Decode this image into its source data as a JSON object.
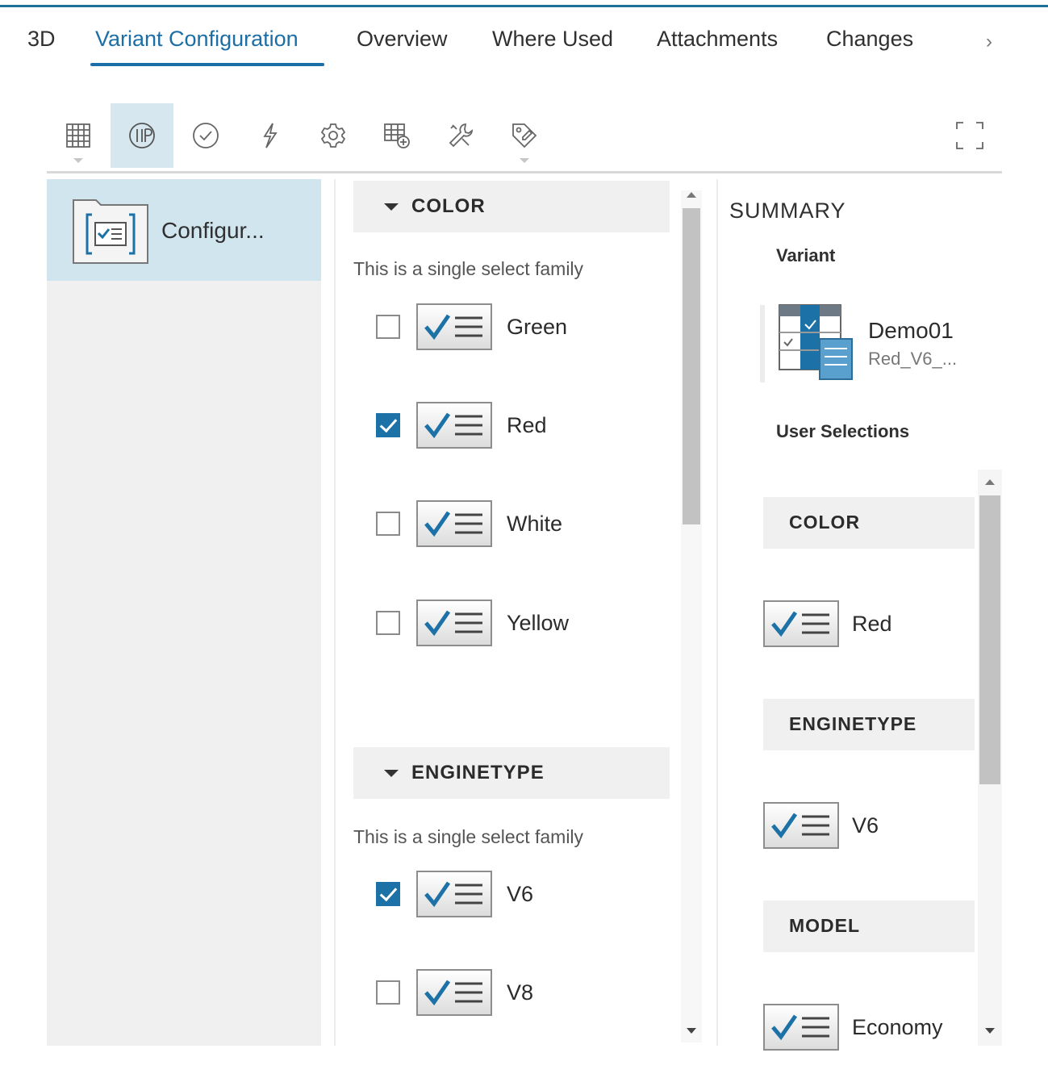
{
  "tabs": [
    {
      "label": "3D"
    },
    {
      "label": "Variant Configuration"
    },
    {
      "label": "Overview"
    },
    {
      "label": "Where Used"
    },
    {
      "label": "Attachments"
    },
    {
      "label": "Changes"
    }
  ],
  "active_tab": "Variant Configuration",
  "toolbar": {
    "tools": [
      "grid-view-icon",
      "feature-options-icon",
      "validate-check-icon",
      "rules-lightning-icon",
      "settings-gear-icon",
      "add-table-icon",
      "tools-wrench-icon",
      "tag-edit-icon"
    ],
    "active_tool": "feature-options-icon",
    "fullscreen": "fullscreen-icon"
  },
  "tree": {
    "items": [
      {
        "label": "Configur...",
        "icon": "configuration-folder-icon"
      }
    ]
  },
  "families": [
    {
      "name": "COLOR",
      "description": "This is a single select family",
      "options": [
        {
          "label": "Green",
          "checked": false
        },
        {
          "label": "Red",
          "checked": true
        },
        {
          "label": "White",
          "checked": false
        },
        {
          "label": "Yellow",
          "checked": false
        }
      ]
    },
    {
      "name": "ENGINETYPE",
      "description": "This is a single select family",
      "options": [
        {
          "label": "V6",
          "checked": true
        },
        {
          "label": "V8",
          "checked": false
        }
      ]
    }
  ],
  "summary": {
    "title": "SUMMARY",
    "variant_label": "Variant",
    "variant": {
      "name": "Demo01",
      "description": "Red_V6_..."
    },
    "user_selections_label": "User Selections",
    "selections": [
      {
        "family": "COLOR",
        "value": "Red"
      },
      {
        "family": "ENGINETYPE",
        "value": "V6"
      },
      {
        "family": "MODEL",
        "value": "Economy"
      }
    ]
  },
  "colors": {
    "accent": "#1b6ea6",
    "checkbox_checked": "#1c72a6",
    "selection_bg": "#d0e5ee",
    "panel_bg": "#f0f0f0"
  }
}
